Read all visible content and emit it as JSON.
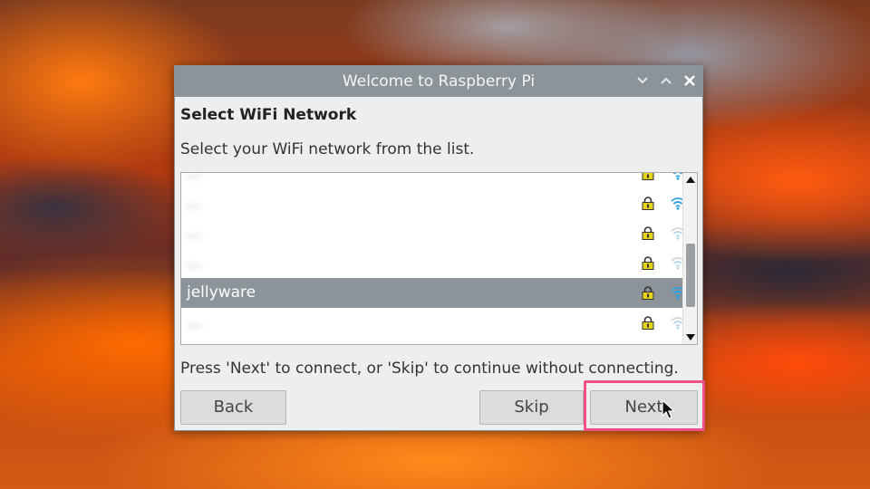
{
  "window": {
    "title": "Welcome to Raspberry Pi",
    "heading": "Select WiFi Network",
    "description": "Select your WiFi network from the list.",
    "instructions": "Press 'Next' to connect, or 'Skip' to continue without connecting."
  },
  "networks": [
    {
      "ssid": "...",
      "secured": true,
      "signal": "strong",
      "selected": false,
      "obscured": true
    },
    {
      "ssid": "...",
      "secured": true,
      "signal": "strong",
      "selected": false,
      "obscured": true
    },
    {
      "ssid": "...",
      "secured": true,
      "signal": "weak",
      "selected": false,
      "obscured": true
    },
    {
      "ssid": "...",
      "secured": true,
      "signal": "weak",
      "selected": false,
      "obscured": true
    },
    {
      "ssid": "jellyware",
      "secured": true,
      "signal": "strong",
      "selected": true,
      "obscured": false
    },
    {
      "ssid": "...",
      "secured": true,
      "signal": "weak",
      "selected": false,
      "obscured": true
    }
  ],
  "buttons": {
    "back": "Back",
    "skip": "Skip",
    "next": "Next"
  },
  "colors": {
    "titlebar": "#8c9499",
    "selection": "#8c949a",
    "wifi_strong": "#2aa0e6",
    "lock": "#e7d21b",
    "highlight": "#f0508a"
  },
  "icons": {
    "minimize": "chevron-down-icon",
    "maximize": "chevron-up-icon",
    "close": "close-icon",
    "lock": "lock-icon",
    "wifi": "wifi-icon"
  }
}
